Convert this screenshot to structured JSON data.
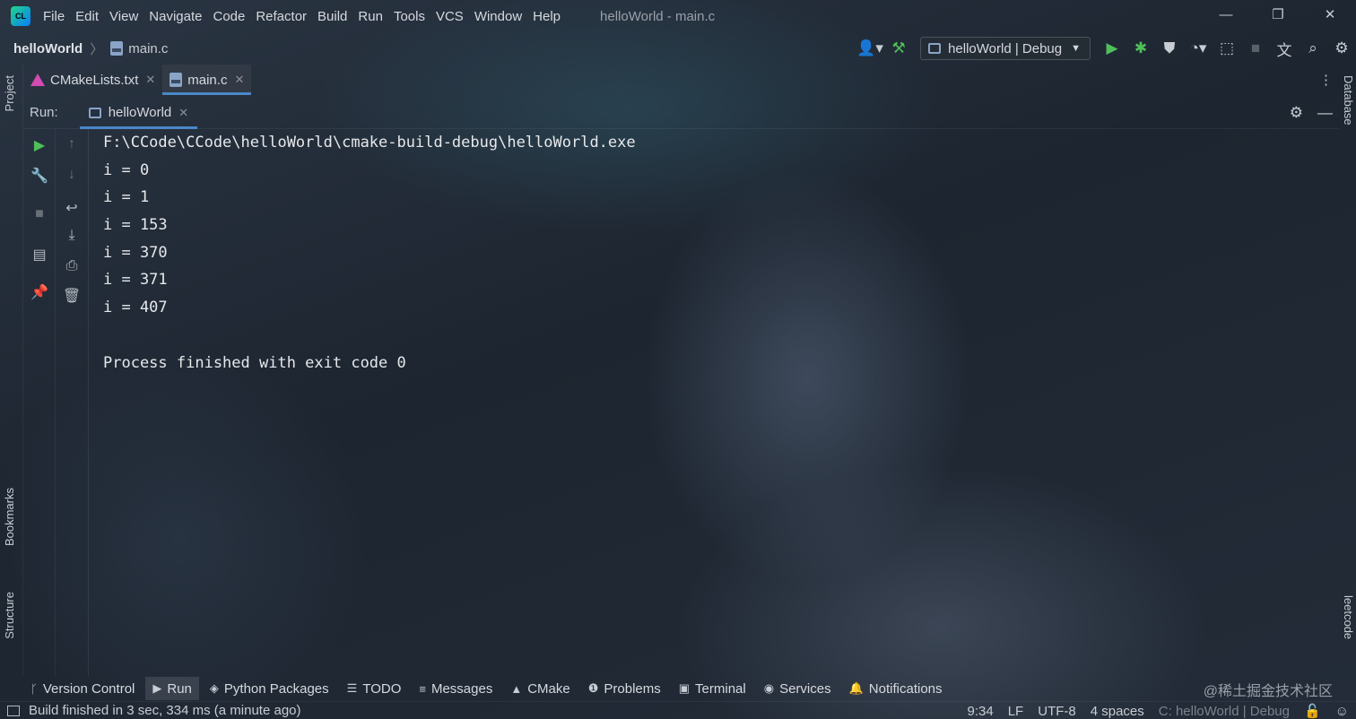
{
  "window": {
    "title": "helloWorld - main.c",
    "minimize": "—",
    "restore": "❐",
    "close": "✕"
  },
  "menu": [
    "File",
    "Edit",
    "View",
    "Navigate",
    "Code",
    "Refactor",
    "Build",
    "Run",
    "Tools",
    "VCS",
    "Window",
    "Help"
  ],
  "breadcrumb": {
    "project": "helloWorld",
    "file": "main.c"
  },
  "run_config": {
    "label": "helloWorld | Debug"
  },
  "editor_tabs": [
    {
      "label": "CMakeLists.txt",
      "active": false
    },
    {
      "label": "main.c",
      "active": true
    }
  ],
  "left_stripe": {
    "project": "Project",
    "bookmarks": "Bookmarks",
    "structure": "Structure"
  },
  "right_stripe": {
    "database": "Database",
    "leetcode": "leetcode"
  },
  "run_panel": {
    "label": "Run:",
    "tab": "helloWorld"
  },
  "console": {
    "lines": [
      "F:\\CCode\\CCode\\helloWorld\\cmake-build-debug\\helloWorld.exe",
      "i = 0",
      "i = 1",
      "i = 153",
      "i = 370",
      "i = 371",
      "i = 407",
      "",
      "Process finished with exit code 0"
    ]
  },
  "tool_windows": [
    {
      "label": "Version Control",
      "icon": "branch-icon",
      "active": false
    },
    {
      "label": "Run",
      "icon": "play-icon",
      "active": true
    },
    {
      "label": "Python Packages",
      "icon": "layers-icon",
      "active": false
    },
    {
      "label": "TODO",
      "icon": "list-icon",
      "active": false
    },
    {
      "label": "Messages",
      "icon": "messages-icon",
      "active": false
    },
    {
      "label": "CMake",
      "icon": "cmake-icon",
      "active": false
    },
    {
      "label": "Problems",
      "icon": "problems-icon",
      "active": false
    },
    {
      "label": "Terminal",
      "icon": "terminal-icon",
      "active": false
    },
    {
      "label": "Services",
      "icon": "services-icon",
      "active": false
    },
    {
      "label": "Notifications",
      "icon": "bell-icon",
      "active": false
    }
  ],
  "watermark": "@稀土掘金技术社区",
  "status": {
    "message": "Build finished in 3 sec, 334 ms (a minute ago)",
    "position": "9:34",
    "line_separator": "LF",
    "encoding": "UTF-8",
    "indent": "4 spaces",
    "context": "C: helloWorld | Debug"
  },
  "colors": {
    "accent": "#4a88c7",
    "run_green": "#4fbf5a",
    "background": "#1f2630"
  }
}
